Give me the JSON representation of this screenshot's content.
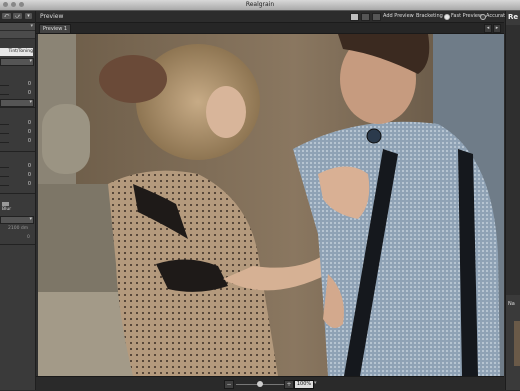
{
  "window": {
    "title": "Realgrain"
  },
  "left_panel": {
    "nav_back": "⤺",
    "nav_forward": "⤻",
    "section_tab": "Tint/Toning",
    "sliders_group1": [
      "0",
      "0",
      "0"
    ],
    "sliders_group2": [
      "0",
      "0",
      "0"
    ],
    "sliders_group3": [
      "0",
      "0",
      "0"
    ],
    "blur_label": "Blur",
    "size_value": "2100 dm",
    "last_value": "0"
  },
  "preview_toolbar": {
    "label": "Preview",
    "add_preview": "Add Preview",
    "bracketing": "Bracketing",
    "fast_preview": "Fast Preview",
    "accurate": "Accurate",
    "render_mode": "Fast Preview"
  },
  "preview_tabs": [
    {
      "label": "Preview 1"
    }
  ],
  "zoom": {
    "minus": "−",
    "plus": "+",
    "value": "100%",
    "level": 0.45
  },
  "right_panel": {
    "title": "Re",
    "section_label": "Na"
  },
  "colors": {
    "panel": "#3a3a3a",
    "toolbar": "#2c2c2c",
    "photo_background": "#6a5a48",
    "accent_light": "#e7e7e7"
  }
}
